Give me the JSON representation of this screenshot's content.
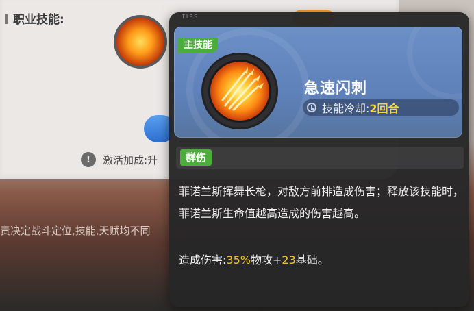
{
  "background": {
    "section_label": "职业技能:",
    "activate_label": "激活加成:",
    "activate_value": "升",
    "description": "责决定战斗定位,技能,天赋均不同"
  },
  "tooltip": {
    "tips_label": "TIPS",
    "main_tag": "主技能",
    "skill_name": "急速闪刺",
    "cooldown_label": "技能冷却:",
    "cooldown_value": "2回合",
    "type_tag": "群伤",
    "description": "菲诺兰斯挥舞长枪，对敌方前排造成伤害；释放该技能时，菲诺兰斯生命值越高造成的伤害越高。",
    "damage": {
      "label": "造成伤害:",
      "percent": "35%",
      "stat": "物攻+",
      "base": "23",
      "suffix": "基础。"
    }
  },
  "colors": {
    "header_blue": "#6c8fc6",
    "tag_green": "#4cae3a",
    "highlight_yellow": "#f4c430"
  },
  "icons": [
    "clock-icon",
    "info-icon",
    "skill-spear-icon"
  ]
}
